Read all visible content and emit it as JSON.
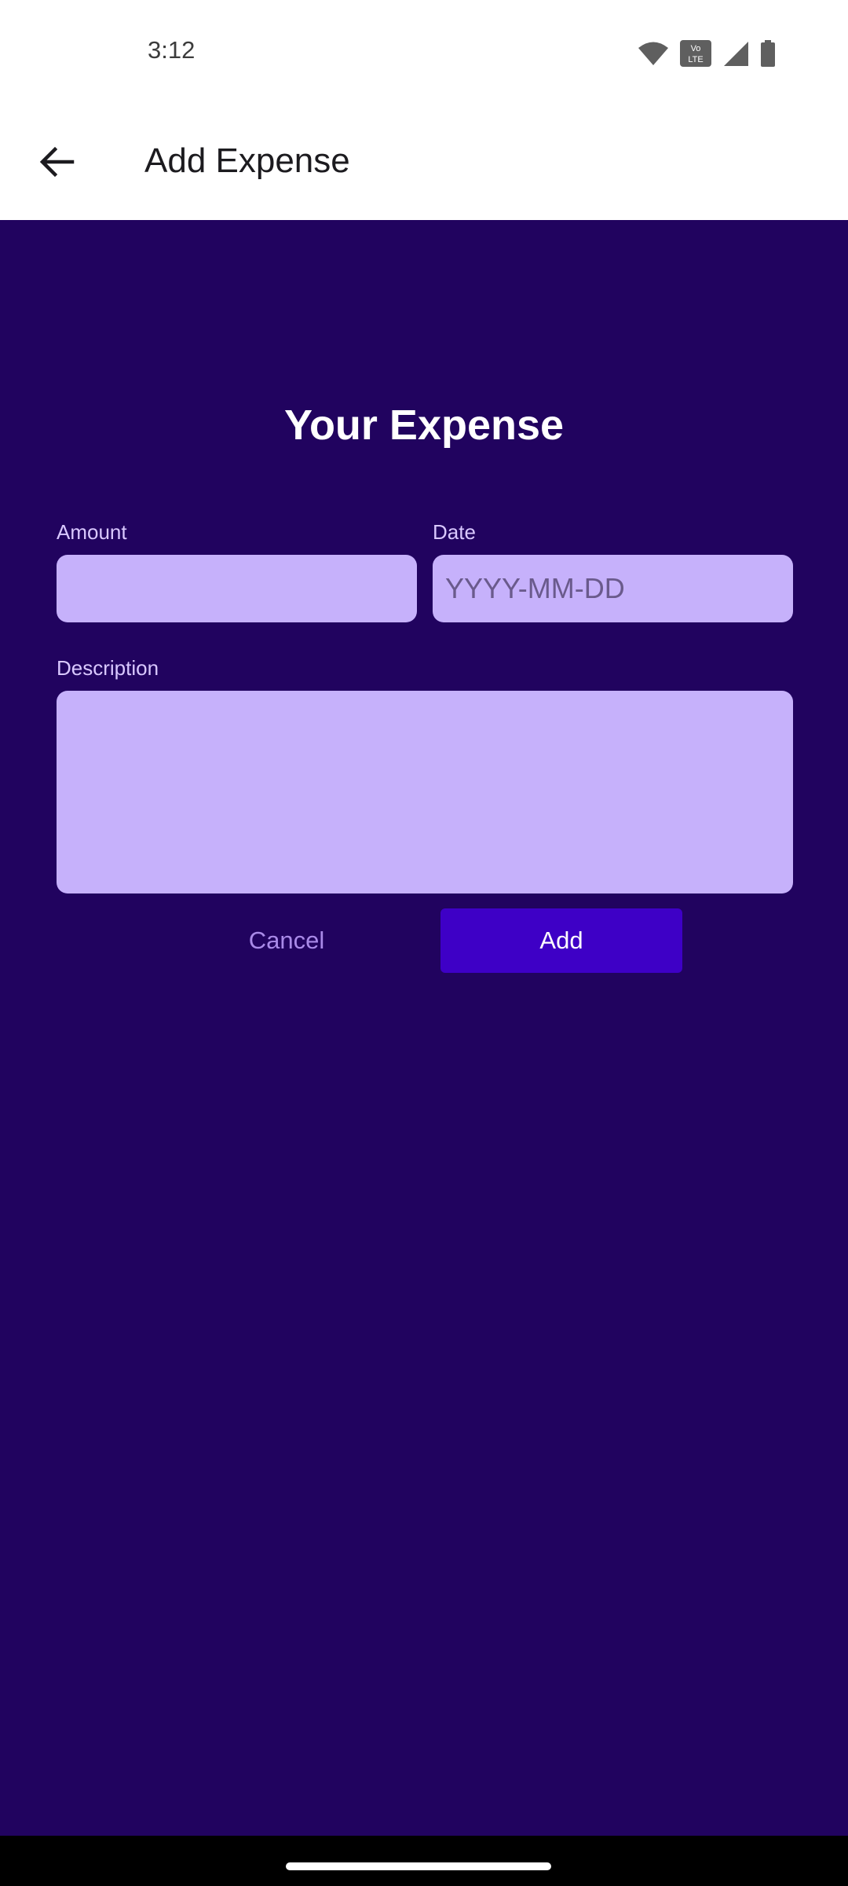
{
  "status_bar": {
    "time": "3:12",
    "icons": [
      "wifi-icon",
      "volte-icon",
      "signal-icon",
      "battery-icon"
    ],
    "volte_text": "Vo LTE"
  },
  "app_bar": {
    "title": "Add Expense",
    "back_icon": "arrow-left-icon"
  },
  "form": {
    "heading": "Your Expense",
    "amount": {
      "label": "Amount",
      "value": "",
      "placeholder": ""
    },
    "date": {
      "label": "Date",
      "value": "",
      "placeholder": "YYYY-MM-DD"
    },
    "description": {
      "label": "Description",
      "value": "",
      "placeholder": ""
    },
    "cancel_label": "Cancel",
    "add_label": "Add"
  },
  "colors": {
    "background": "#21035f",
    "field": "#c6b1fb",
    "primary_button": "#3e00c6",
    "cancel_text": "#a98ae8"
  }
}
